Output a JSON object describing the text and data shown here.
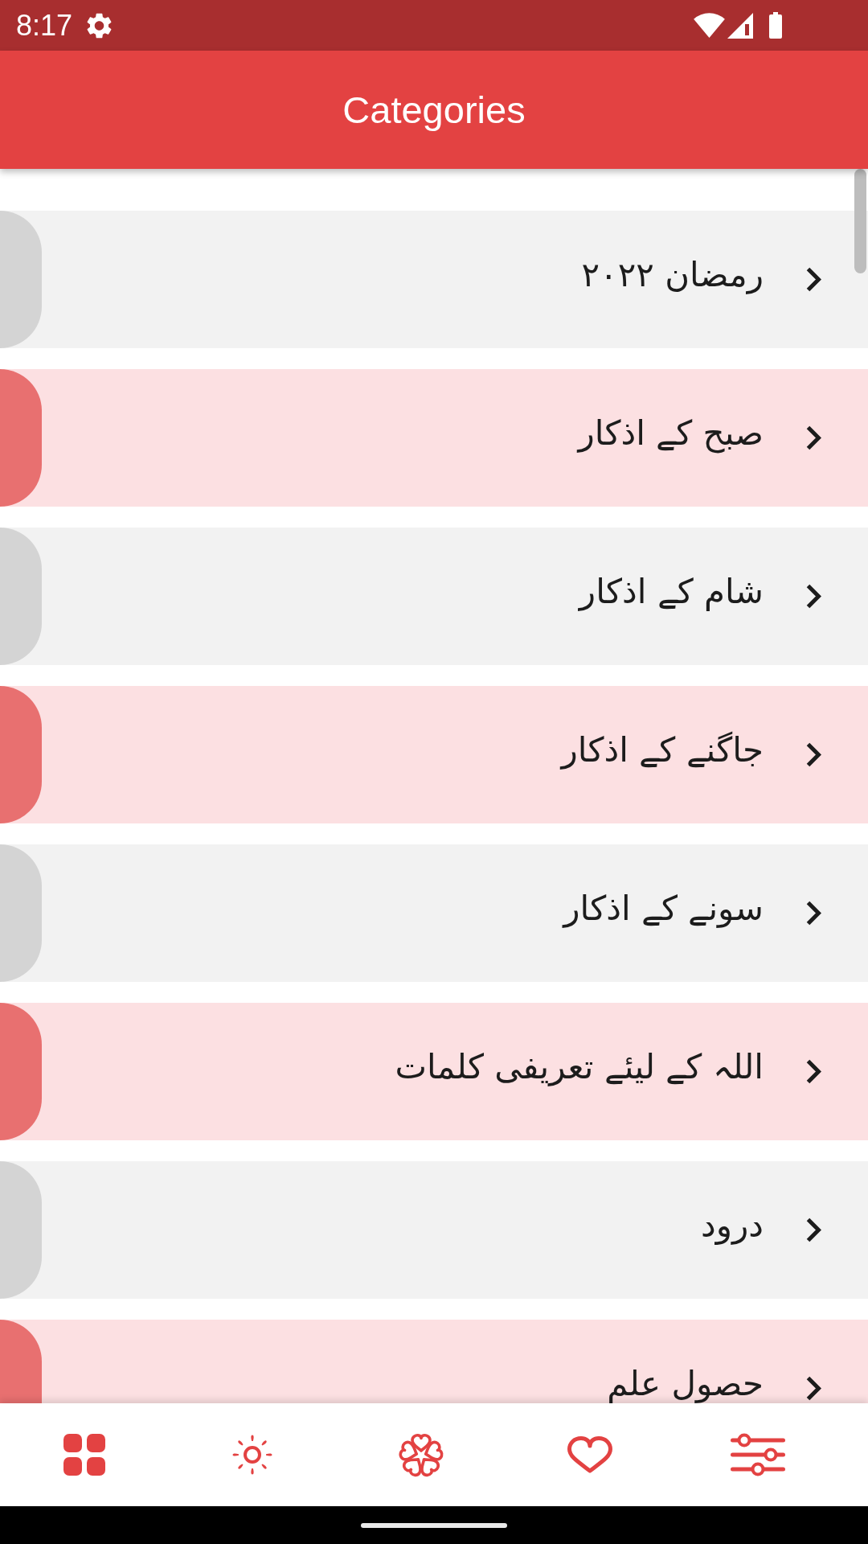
{
  "status_bar": {
    "time": "8:17"
  },
  "app_bar": {
    "title": "Categories"
  },
  "categories": [
    {
      "label": "رمضان ۲۰۲۲"
    },
    {
      "label": "صبح کے اذکار"
    },
    {
      "label": "شام کے اذکار"
    },
    {
      "label": "جاگنے کے اذکار"
    },
    {
      "label": "سونے کے اذکار"
    },
    {
      "label": "اللہ کے لیئے تعریفی کلمات"
    },
    {
      "label": "درود"
    },
    {
      "label": "حصول علم"
    }
  ],
  "bottom_nav": [
    {
      "kind": "grid"
    },
    {
      "kind": "sun"
    },
    {
      "kind": "flower"
    },
    {
      "kind": "heart"
    },
    {
      "kind": "sliders"
    }
  ]
}
